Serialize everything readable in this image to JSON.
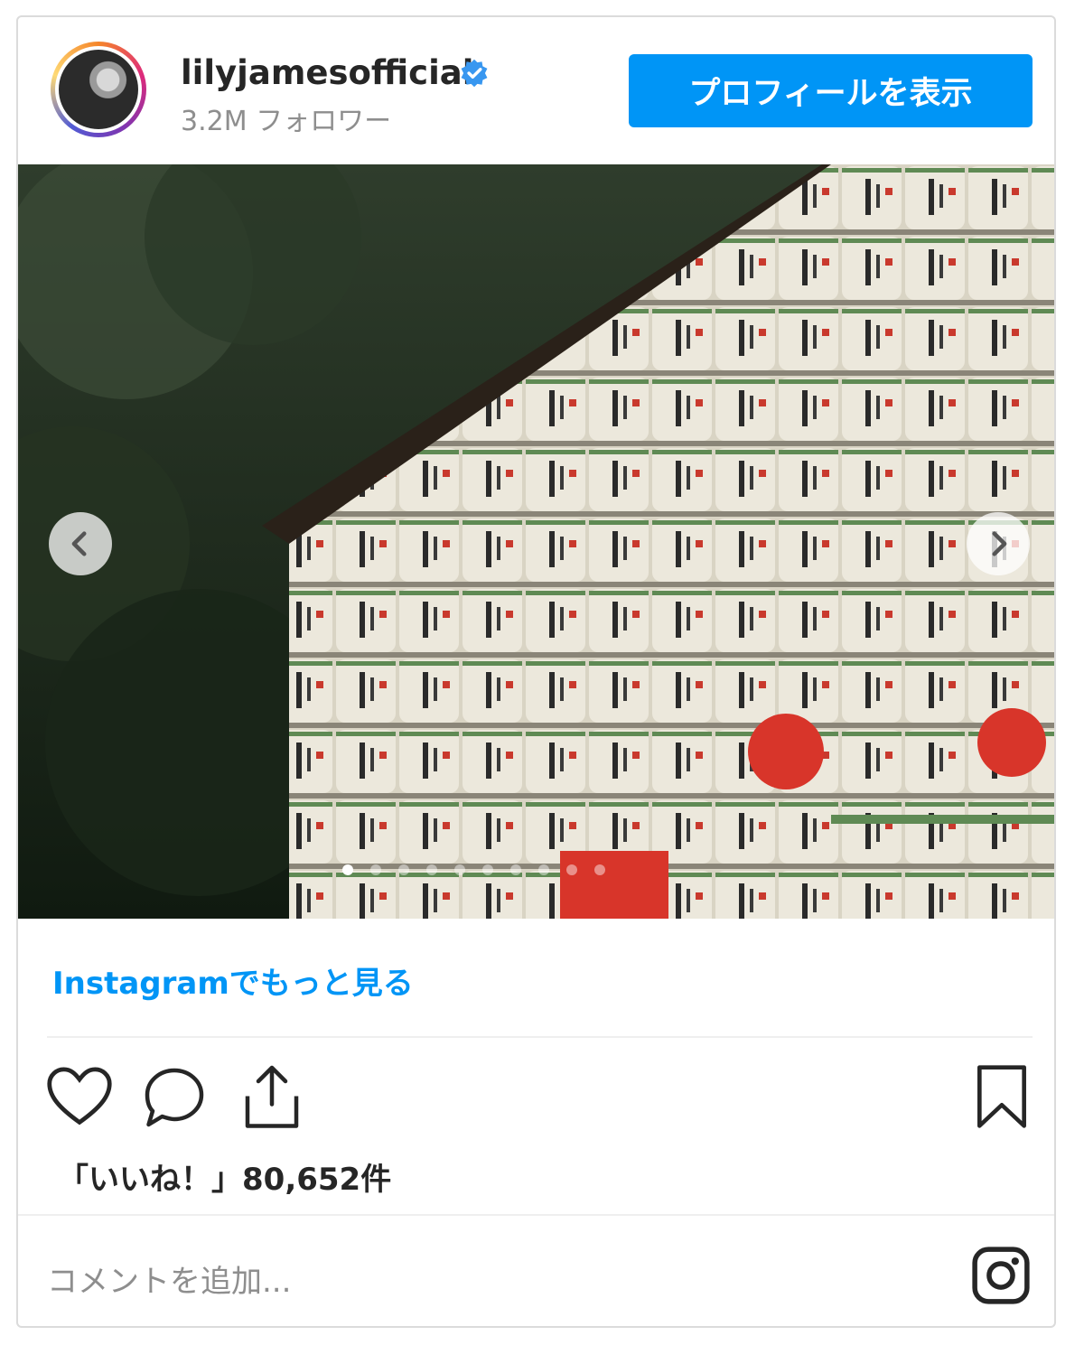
{
  "header": {
    "username": "lilyjamesofficial",
    "followers": "3.2M フォロワー",
    "profile_button": "プロフィールを表示"
  },
  "post": {
    "image_alt": "sake barrels",
    "carousel": {
      "total": 10,
      "current": 1
    },
    "more_link": "Instagramでもっと見る",
    "likes_text": "「いいね！」80,652件",
    "comment_placeholder": "コメントを追加..."
  },
  "icons": {
    "verified": "verified-badge-icon",
    "prev": "chevron-left-icon",
    "next": "chevron-right-icon",
    "like": "heart-icon",
    "comment": "comment-icon",
    "share": "share-icon",
    "save": "bookmark-icon",
    "brand": "instagram-icon"
  },
  "colors": {
    "accent": "#0095f6",
    "text": "#262626",
    "muted": "#8e8e8e",
    "border": "#dbdbdb"
  }
}
